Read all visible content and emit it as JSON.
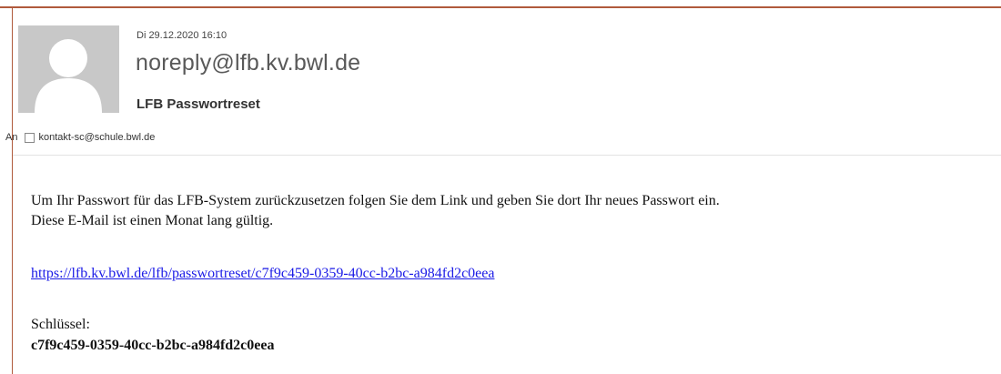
{
  "email": {
    "sent_date": "Di 29.12.2020 16:10",
    "sender": "noreply@lfb.kv.bwl.de",
    "subject": "LFB Passwortreset",
    "to_label": "An",
    "recipient": "kontakt-sc@schule.bwl.de"
  },
  "body": {
    "line1": "Um Ihr Passwort für das LFB-System zurückzusetzen folgen Sie dem Link und geben Sie dort Ihr neues Passwort ein.",
    "line2": "Diese E-Mail ist einen Monat lang gültig.",
    "link": "https://lfb.kv.bwl.de/lfb/passwortreset/c7f9c459-0359-40cc-b2bc-a984fd2c0eea",
    "key_label": "Schlüssel:",
    "key_value": "c7f9c459-0359-40cc-b2bc-a984fd2c0eea"
  },
  "colors": {
    "accent_rule": "#b05a3c",
    "link": "#1a1ae6",
    "avatar_bg": "#c8c8c8"
  },
  "icons": {
    "avatar": "person-placeholder-icon",
    "recipient": "contact-checkbox-icon"
  }
}
